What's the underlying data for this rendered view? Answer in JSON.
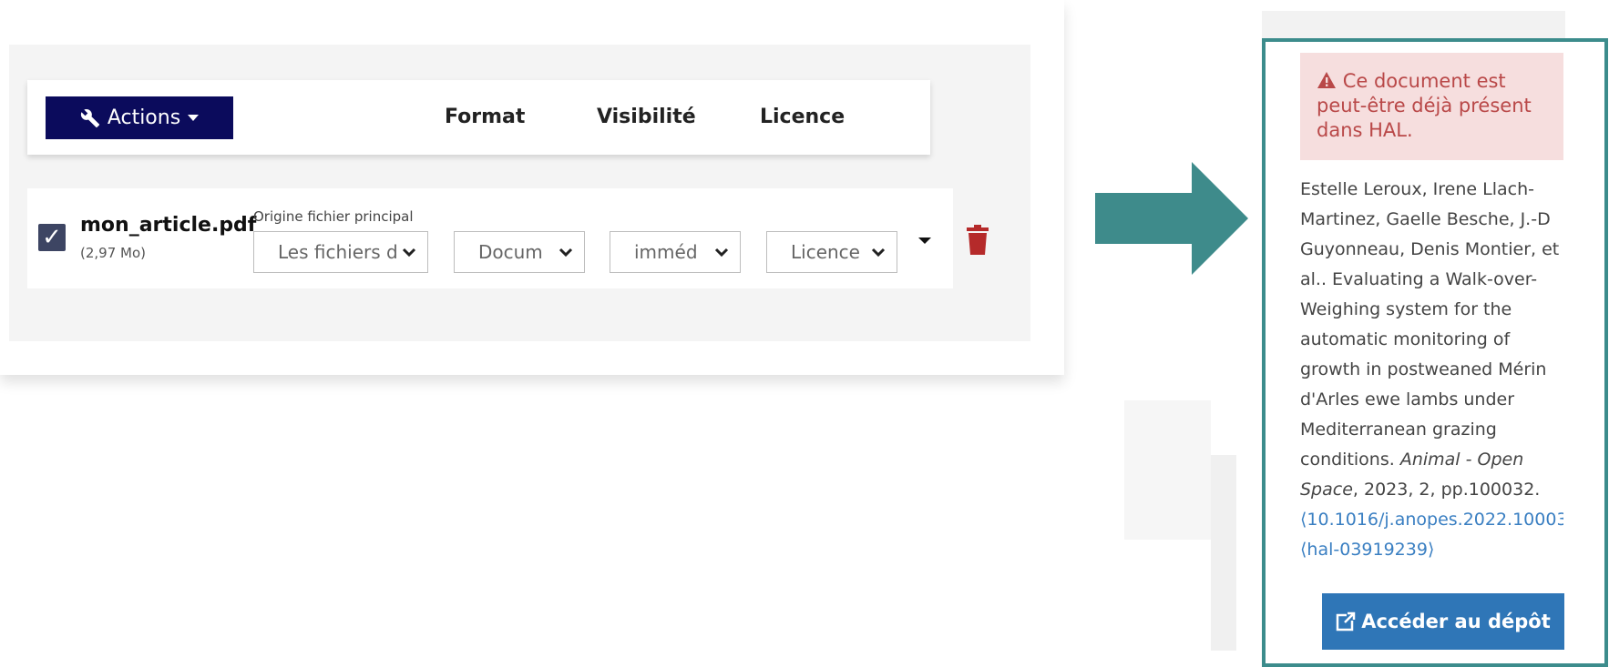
{
  "toolbar": {
    "actions_label": "Actions",
    "col_format": "Format",
    "col_visibility": "Visibilité",
    "col_licence": "Licence"
  },
  "file": {
    "name": "mon_article.pdf",
    "size": "(2,97 Mo)",
    "checked": true,
    "origin_label": "Origine fichier principal",
    "origin_value": "Les fichiers d",
    "format_value": "Docum",
    "visibility_value": "imméd",
    "licence_value": "Licence"
  },
  "side": {
    "alert_text": "Ce document est peut-être déjà présent dans HAL.",
    "alert_line1": "Ce document est",
    "alert_line2": "peut-être déjà présent",
    "alert_line3": "dans HAL.",
    "cit_l1": "Estelle Leroux, Irene Llach-",
    "cit_l2": "Martinez, Gaelle Besche, J.-D",
    "cit_l3": "Guyonneau, Denis Montier, et",
    "cit_l4": "al.. Evaluating a Walk-over-",
    "cit_l5": "Weighing system for the",
    "cit_l6": "automatic monitoring of",
    "cit_l7": "growth in postweaned Mérin",
    "cit_l8": "d'Arles ewe lambs under",
    "cit_l9": "Mediterranean grazing",
    "cit_l10a": "conditions. ",
    "cit_l10b": "Animal - Open",
    "cit_l11a": "Space",
    "cit_l11b": ", 2023, 2, pp.100032.",
    "doi": "⟨10.1016/j.anopes.2022.10003",
    "hal_id": "⟨hal-03919239⟩",
    "deposit_button": "Accéder au dépôt"
  },
  "colors": {
    "actions_bg": "#0b0b5c",
    "panel_border": "#3c8c8c",
    "arrow": "#3e8b8b",
    "alert_bg": "#f6dede",
    "alert_text": "#b94848",
    "deposit_bg": "#2f76b7",
    "trash": "#b52a2a"
  },
  "icons": {
    "actions": "wrench-icon",
    "select_chevron": "chevron-down-icon",
    "delete": "trash-icon",
    "alert": "warning-triangle-icon",
    "deposit": "external-link-icon"
  }
}
